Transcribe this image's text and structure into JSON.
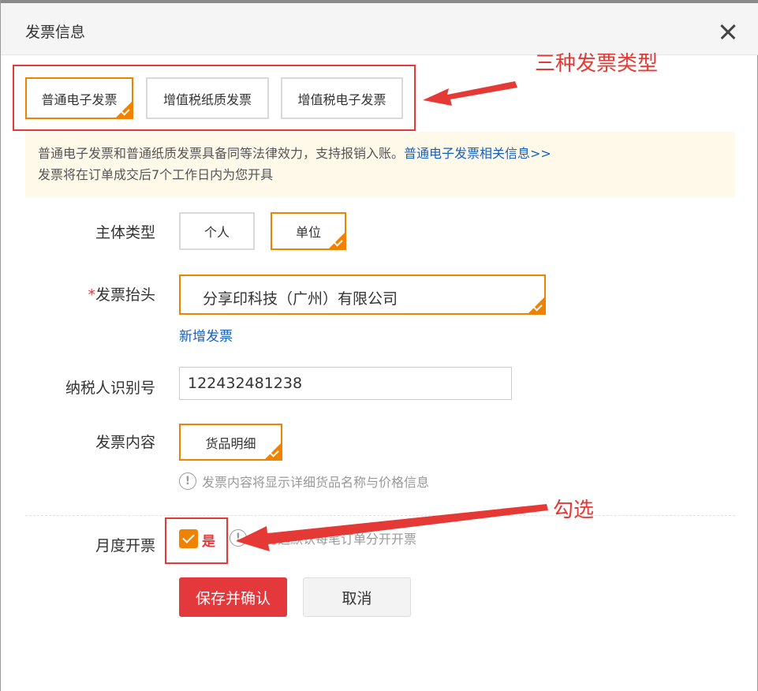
{
  "dialog": {
    "title": "发票信息"
  },
  "invoice_types": [
    {
      "label": "普通电子发票",
      "selected": true
    },
    {
      "label": "增值税纸质发票",
      "selected": false
    },
    {
      "label": "增值税电子发票",
      "selected": false
    }
  ],
  "notice": {
    "line1": "普通电子发票和普通纸质发票具备同等法律效力，支持报销入账。",
    "link": "普通电子发票相关信息>>",
    "line2": "发票将在订单成交后7个工作日内为您开具"
  },
  "subject": {
    "label": "主体类型",
    "options": [
      {
        "label": "个人",
        "selected": false
      },
      {
        "label": "单位",
        "selected": true
      }
    ]
  },
  "invoice_title": {
    "required_mark": "*",
    "label": "发票抬头",
    "value": "分享印科技（广州）有限公司",
    "add_link": "新增发票"
  },
  "taxpayer": {
    "label": "纳税人识别号",
    "value": "122432481238"
  },
  "content": {
    "label": "发票内容",
    "option": "货品明细",
    "hint_icon": "!",
    "hint": "发票内容将显示详细货品名称与价格信息"
  },
  "monthly": {
    "label": "月度开票",
    "checked": true,
    "yes_label": "是",
    "hint": "不勾选默认每笔订单分开开票"
  },
  "buttons": {
    "save": "保存并确认",
    "cancel": "取消"
  },
  "annotations": {
    "types_note": "三种发票类型",
    "check_note": "勾选",
    "color": "#e53935"
  },
  "colors": {
    "accent": "#f08200",
    "primary_button": "#e4393c",
    "link": "#1560bd"
  }
}
